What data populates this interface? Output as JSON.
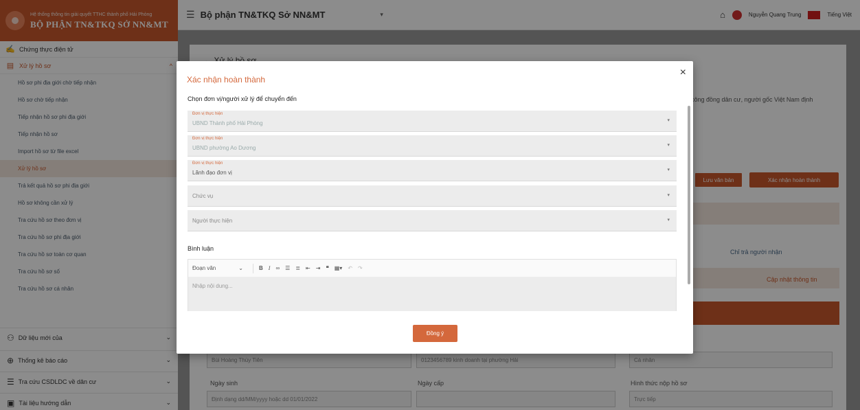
{
  "header": {
    "brand_subtitle": "Hệ thống thông tin giải quyết TTHC thành phố Hải Phòng",
    "brand_name": "BỘ PHẬN TN&TKQ SỞ NN&MT",
    "department": "Bộ phận TN&TKQ Sở NN&MT",
    "user_name": "Nguyễn Quang Trung",
    "language": "Tiếng Việt"
  },
  "sidebar": {
    "top_item": "Chứng thực điện tử",
    "group_label": "Xử lý hồ sơ",
    "sub_items": [
      "Hồ sơ phi địa giới chờ tiếp nhận",
      "Hồ sơ chờ tiếp nhận",
      "Tiếp nhận hồ sơ phi địa giới",
      "Tiếp nhận hồ sơ",
      "Import hồ sơ từ file excel",
      "Xử lý hồ sơ",
      "Trả kết quả hồ sơ phi địa giới",
      "Hồ sơ không cần xử lý",
      "Tra cứu hồ sơ theo đơn vị",
      "Tra cứu hồ sơ phi địa giới",
      "Tra cứu hồ sơ toàn cơ quan",
      "Tra cứu hồ sơ số",
      "Tra cứu hồ sơ cá nhân"
    ],
    "bottom_items": [
      "Dữ liệu mới của",
      "Thống kê báo cáo",
      "Tra cứu CSDLDC về dân cư",
      "Tài liệu hướng dẫn"
    ]
  },
  "background": {
    "page_title": "Xử lý hồ sơ",
    "desc_snippet": "công đồng dân cư, người gốc Việt Nam định",
    "btn_save": "Lưu văn bản",
    "btn_confirm": "Xác nhận hoàn thành",
    "link_person": "Chỉ trả người nhận",
    "link_update": "Cập nhật thông tin",
    "field_name": "Bùi Hoàng Thùy Tiên",
    "field_id": "0123456789 kinh doanh tại phường Hải",
    "field_type": "Cá nhân",
    "dob_label": "Ngày sinh",
    "dob_placeholder": "Định dạng dd/MM/yyyy hoặc dd 01/01/2022",
    "issue_label": "Ngày cấp",
    "method_label": "Hình thức nộp hồ sơ",
    "method_value": "Trực tiếp"
  },
  "modal": {
    "title": "Xác nhận hoàn thành",
    "close_symbol": "×",
    "section_label": "Chọn đơn vị/người xử lý để chuyển đến",
    "selects": [
      {
        "label": "Đơn vị thực hiện",
        "value": "UBND Thành phố Hải Phòng",
        "dim": true
      },
      {
        "label": "Đơn vị thực hiện",
        "value": "UBND phường Ao Dương",
        "dim": true
      },
      {
        "label": "Đơn vị thực hiện",
        "value": "Lãnh đạo đơn vị",
        "dim": false
      },
      {
        "label": "",
        "value": "Chức vụ",
        "dim": false
      },
      {
        "label": "",
        "value": "Người thực hiện",
        "dim": false
      }
    ],
    "comment_label": "Bình luận",
    "toolbar_heading": "Đoạn văn",
    "editor_placeholder": "Nhập nội dung...",
    "submit_label": "Đồng ý"
  },
  "colors": {
    "brand": "#c8582c",
    "accent": "#d4683c"
  }
}
